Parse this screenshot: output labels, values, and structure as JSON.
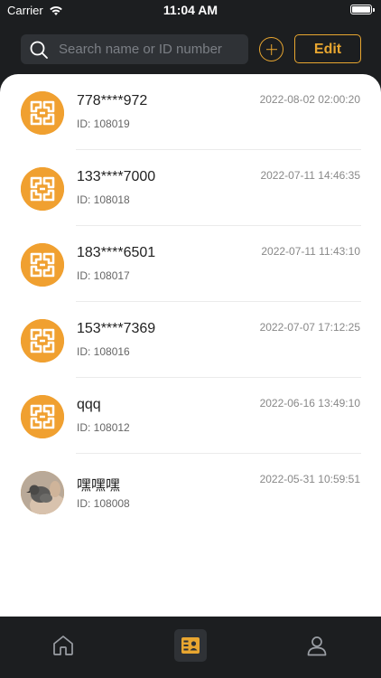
{
  "status_bar": {
    "carrier": "Carrier",
    "time": "11:04 AM"
  },
  "search": {
    "placeholder": "Search name or ID number"
  },
  "header": {
    "edit_label": "Edit"
  },
  "colors": {
    "accent": "#e8a630",
    "avatar_bg": "#f0a030",
    "background": "#1c1e20"
  },
  "contacts": [
    {
      "name": "778****972",
      "id": "ID: 108019",
      "time": "2022-08-02 02:00:20",
      "avatar": "logo"
    },
    {
      "name": "133****7000",
      "id": "ID: 108018",
      "time": "2022-07-11 14:46:35",
      "avatar": "logo"
    },
    {
      "name": "183****6501",
      "id": "ID: 108017",
      "time": "2022-07-11 11:43:10",
      "avatar": "logo"
    },
    {
      "name": "153****7369",
      "id": "ID: 108016",
      "time": "2022-07-07 17:12:25",
      "avatar": "logo"
    },
    {
      "name": "qqq",
      "id": "ID: 108012",
      "time": "2022-06-16 13:49:10",
      "avatar": "logo"
    },
    {
      "name": "嘿嘿嘿",
      "id": "ID: 108008",
      "time": "2022-05-31 10:59:51",
      "avatar": "photo"
    }
  ],
  "tab_bar": {
    "items": [
      {
        "icon": "home-icon",
        "active": false
      },
      {
        "icon": "contacts-icon",
        "active": true
      },
      {
        "icon": "profile-icon",
        "active": false
      }
    ]
  }
}
